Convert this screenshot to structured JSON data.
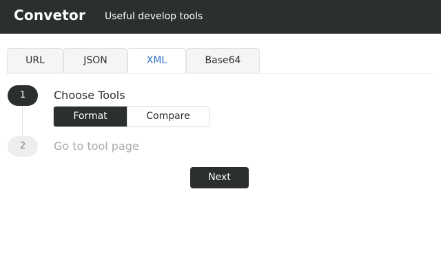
{
  "header": {
    "brand": "Convetor",
    "tagline": "Useful develop tools",
    "background_color": "#2b2f2d"
  },
  "tabs": [
    {
      "label": "URL",
      "active": false
    },
    {
      "label": "JSON",
      "active": false
    },
    {
      "label": "XML",
      "active": true
    },
    {
      "label": "Base64",
      "active": false
    }
  ],
  "accent_color": "#2f6fca",
  "steps": [
    {
      "number": "1",
      "title": "Choose Tools",
      "state": "active",
      "options": [
        {
          "label": "Format",
          "selected": true
        },
        {
          "label": "Compare",
          "selected": false
        }
      ]
    },
    {
      "number": "2",
      "title": "Go to tool page",
      "state": "inactive"
    }
  ],
  "next_button": {
    "label": "Next"
  }
}
